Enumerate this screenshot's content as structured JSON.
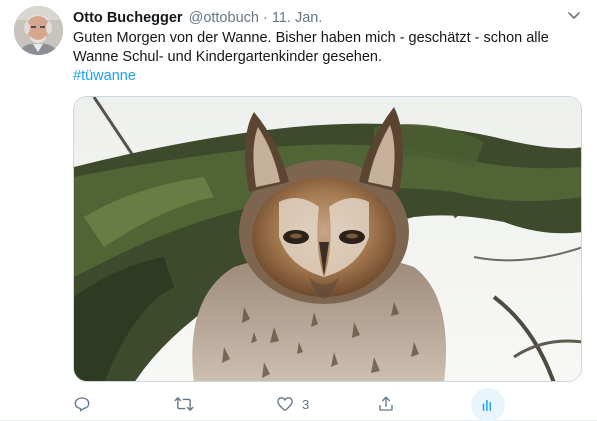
{
  "tweet": {
    "display_name": "Otto Buchegger",
    "handle": "@ottobuch",
    "separator": "·",
    "date": "11. Jan.",
    "text_line1": "Guten Morgen von der Wanne. Bisher haben mich - geschätzt - schon alle",
    "text_line2": "Wanne Schul- und Kindergartenkinder gesehen.",
    "hashtag": "#tüwanne",
    "media_subject": "long-eared owl on mossy branch"
  },
  "actions": {
    "reply": {
      "icon": "reply-icon"
    },
    "retweet": {
      "icon": "retweet-icon"
    },
    "like": {
      "icon": "heart-icon",
      "count": "3"
    },
    "share": {
      "icon": "share-icon"
    },
    "analytics": {
      "icon": "analytics-icon"
    }
  },
  "colors": {
    "accent": "#1da1f2",
    "secondary_text": "#657786",
    "primary_text": "#14171a",
    "analytics_highlight": "#e8f5fd"
  }
}
